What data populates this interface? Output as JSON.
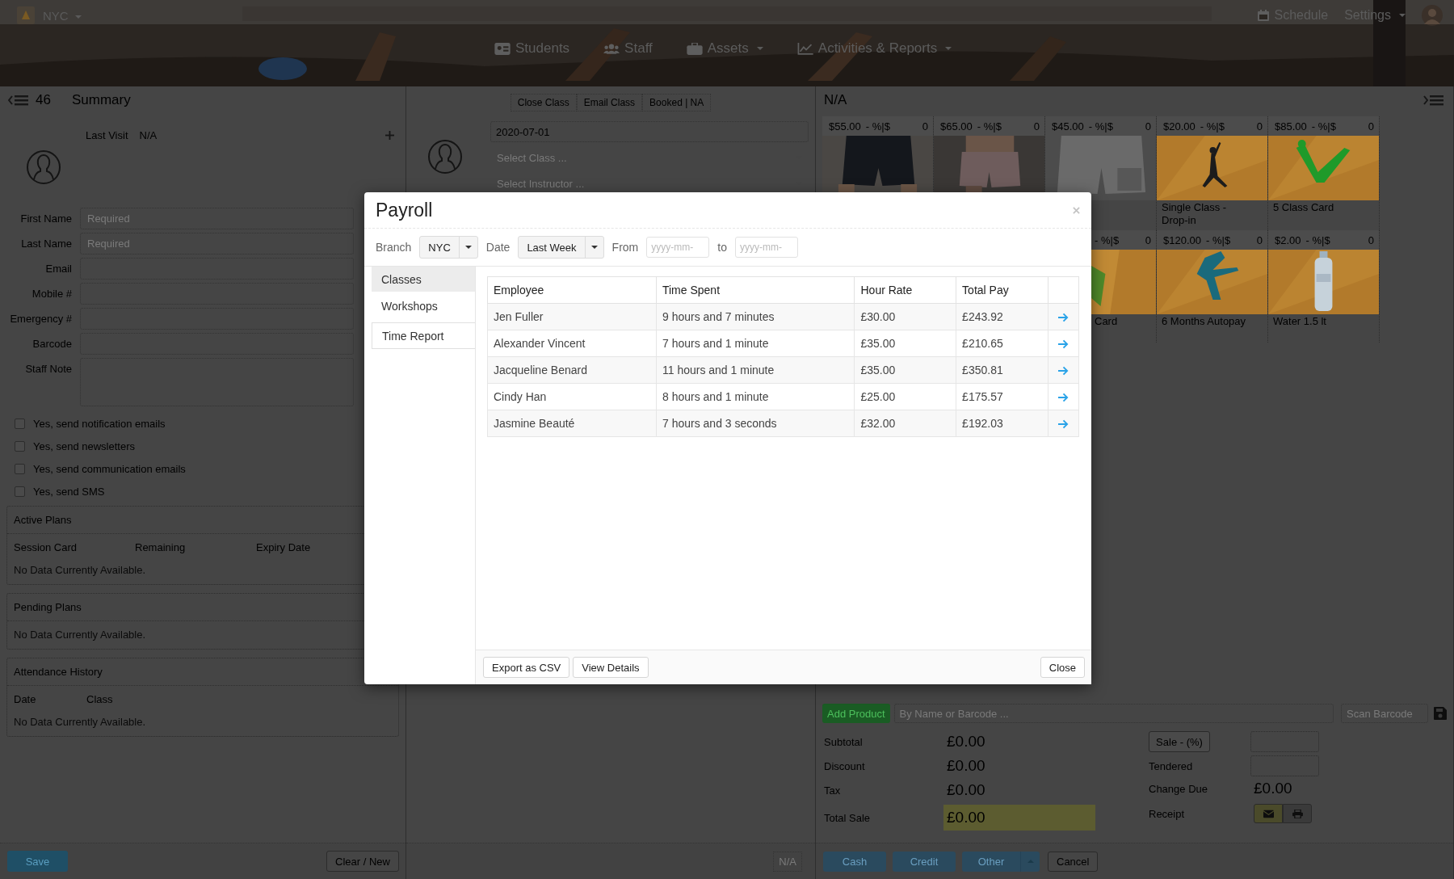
{
  "header": {
    "branch": "NYC",
    "nav": [
      {
        "label": "Students",
        "dropdown": false
      },
      {
        "label": "Staff",
        "dropdown": false
      },
      {
        "label": "Assets",
        "dropdown": true
      },
      {
        "label": "Activities & Reports",
        "dropdown": true
      }
    ],
    "schedule": "Schedule",
    "settings": "Settings"
  },
  "member_panel": {
    "count": "46",
    "title": "Summary",
    "last_visit_label": "Last Visit",
    "last_visit": "N/A",
    "fields": [
      {
        "label": "First Name",
        "placeholder": "Required",
        "kind": "input"
      },
      {
        "label": "Last Name",
        "placeholder": "Required",
        "kind": "input"
      },
      {
        "label": "Email",
        "kind": "input"
      },
      {
        "label": "Mobile #",
        "kind": "input"
      },
      {
        "label": "Emergency #",
        "kind": "input"
      },
      {
        "label": "Barcode",
        "kind": "input"
      },
      {
        "label": "Staff Note",
        "kind": "textarea"
      }
    ],
    "checkboxes": [
      {
        "label": "Yes, send notification emails",
        "checked": false
      },
      {
        "label": "Yes, send newsletters",
        "checked": false
      },
      {
        "label": "Yes, send communication emails",
        "checked": false
      },
      {
        "label": "Yes, send SMS",
        "checked": false
      }
    ],
    "sections": [
      {
        "title": "Active Plans",
        "columns": [
          "Session Card",
          "Remaining",
          "Expiry Date"
        ],
        "empty": "No Data Currently Available."
      },
      {
        "title": "Pending Plans",
        "empty": "No Data Currently Available."
      },
      {
        "title": "Attendance History",
        "columns": [
          "Date",
          "Class"
        ],
        "empty": "No Data Currently Available."
      }
    ],
    "save": "Save",
    "clear": "Clear / New"
  },
  "class_panel": {
    "actions": [
      "Close Class",
      "Email Class",
      "Booked | NA"
    ],
    "date": "2020-07-01",
    "class_placeholder": "Select Class ...",
    "instructor_placeholder": "Select Instructor ...",
    "footer": "N/A"
  },
  "pos_panel": {
    "title": "N/A",
    "product_rows": [
      [
        {
          "price": "$55.00",
          "discount": "- %|$",
          "qty": "0",
          "kind": "full"
        },
        {
          "price": "$65.00",
          "discount": "- %|$",
          "qty": "0",
          "kind": "full"
        },
        {
          "price": "$45.00",
          "discount": "- %|$",
          "qty": "0",
          "kind": "full"
        },
        {
          "price": "$20.00",
          "discount": "- %|$",
          "qty": "0",
          "caption": "Single Class - Drop-in",
          "kind": "full"
        },
        {
          "price": "$85.00",
          "discount": "- %|$",
          "qty": "0",
          "caption": "5 Class Card",
          "kind": "full"
        }
      ],
      [
        {
          "discount": "- %|$",
          "qty": "0",
          "caption": "Card",
          "kind": "partial"
        },
        {
          "price": "$120.00",
          "discount": "- %|$",
          "qty": "0",
          "caption": "6 Months Autopay",
          "kind": "full"
        },
        {
          "price": "$2.00",
          "discount": "- %|$",
          "qty": "0",
          "caption": "Water 1.5 lt",
          "kind": "full"
        }
      ]
    ],
    "add_product": "Add Product",
    "search_placeholder": "By Name or Barcode ...",
    "scan_placeholder": "Scan Barcode",
    "totals": [
      {
        "label": "Subtotal",
        "value": "£0.00"
      },
      {
        "label": "Discount",
        "value": "£0.00"
      },
      {
        "label": "Tax",
        "value": "£0.00"
      },
      {
        "label": "Total Sale",
        "value": "£0.00"
      }
    ],
    "sale_button": "Sale - (%)",
    "tendered_label": "Tendered",
    "change_due_label": "Change Due",
    "change_due": "£0.00",
    "receipt_label": "Receipt",
    "receipt_options": [
      {
        "kind": "email",
        "selected": true
      },
      {
        "kind": "print",
        "selected": false
      }
    ],
    "payments": [
      {
        "label": "Cash",
        "dropdown": false
      },
      {
        "label": "Credit",
        "dropdown": false
      },
      {
        "label": "Other",
        "dropdown": true
      }
    ],
    "cancel": "Cancel"
  },
  "modal": {
    "title": "Payroll",
    "branch_label": "Branch",
    "branch": "NYC",
    "date_label": "Date",
    "date": "Last Week",
    "from_label": "From",
    "from_placeholder": "yyyy-mm-",
    "to_label": "to",
    "to_placeholder": "yyyy-mm-",
    "tabs": [
      {
        "label": "Classes",
        "selected": false,
        "hovered": true
      },
      {
        "label": "Workshops",
        "selected": false,
        "hovered": false
      },
      {
        "label": "Time Report",
        "selected": true,
        "hovered": false
      }
    ],
    "table": {
      "columns": [
        "Employee",
        "Time Spent",
        "Hour Rate",
        "Total Pay"
      ],
      "rows": [
        [
          "Jen Fuller",
          "9 hours and 7 minutes",
          "£30.00",
          "£243.92"
        ],
        [
          "Alexander Vincent",
          "7 hours and 1 minute",
          "£35.00",
          "£210.65"
        ],
        [
          "Jacqueline Benard",
          "11 hours and 1 minute",
          "£35.00",
          "£350.81"
        ],
        [
          "Cindy Han",
          "8 hours and 1 minute",
          "£25.00",
          "£175.57"
        ],
        [
          "Jasmine Beauté",
          "7 hours and 3 seconds",
          "£32.00",
          "£192.03"
        ]
      ]
    },
    "buttons": [
      "Export as CSV",
      "View Details"
    ],
    "close_button": "Close"
  }
}
